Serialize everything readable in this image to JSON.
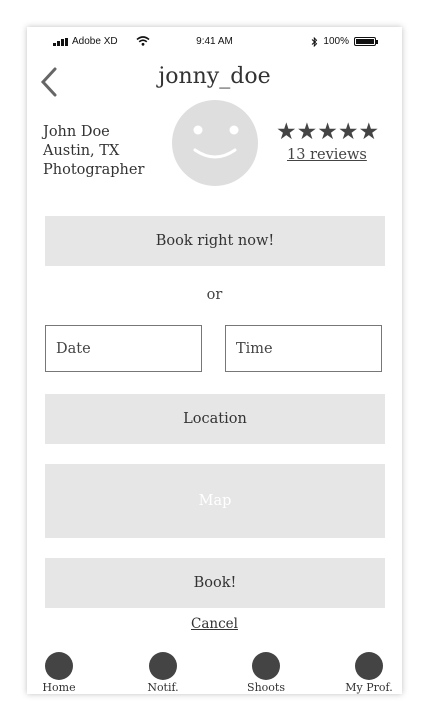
{
  "status_bar": {
    "carrier": "Adobe XD",
    "time": "9:41 AM",
    "battery_text": "100%",
    "battery_level": 1.0
  },
  "header": {
    "username": "jonny_doe"
  },
  "profile": {
    "name": "John Doe",
    "location": "Austin, TX",
    "occupation": "Photographer",
    "rating": 5,
    "stars": "★★★★★",
    "reviews_label": "13 reviews"
  },
  "booking": {
    "book_now_label": "Book right now!",
    "or_label": "or",
    "date_placeholder": "Date",
    "time_placeholder": "Time",
    "location_label": "Location",
    "map_label": "Map",
    "book_label": "Book!",
    "cancel_label": "Cancel"
  },
  "tabbar": {
    "items": [
      {
        "label": "Home"
      },
      {
        "label": "Notif."
      },
      {
        "label": "Shoots"
      },
      {
        "label": "My Prof."
      }
    ]
  },
  "colors": {
    "button_bg": "#e6e6e6",
    "avatar_bg": "#dedede",
    "tab_icon": "#444444"
  }
}
